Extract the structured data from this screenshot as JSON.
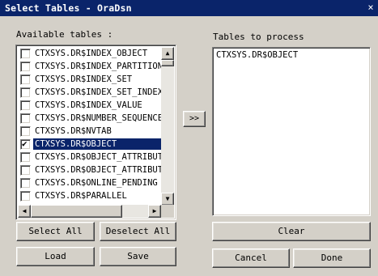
{
  "window": {
    "title": "Select Tables - OraDsn",
    "close_glyph": "×"
  },
  "available": {
    "label": "Available tables :",
    "items": [
      {
        "name": "CTXSYS.DR$INDEX_OBJECT",
        "checked": false,
        "selected": false
      },
      {
        "name": "CTXSYS.DR$INDEX_PARTITION",
        "checked": false,
        "selected": false
      },
      {
        "name": "CTXSYS.DR$INDEX_SET",
        "checked": false,
        "selected": false
      },
      {
        "name": "CTXSYS.DR$INDEX_SET_INDEX",
        "checked": false,
        "selected": false
      },
      {
        "name": "CTXSYS.DR$INDEX_VALUE",
        "checked": false,
        "selected": false
      },
      {
        "name": "CTXSYS.DR$NUMBER_SEQUENCE",
        "checked": false,
        "selected": false
      },
      {
        "name": "CTXSYS.DR$NVTAB",
        "checked": false,
        "selected": false
      },
      {
        "name": "CTXSYS.DR$OBJECT",
        "checked": true,
        "selected": true
      },
      {
        "name": "CTXSYS.DR$OBJECT_ATTRIBUTE",
        "checked": false,
        "selected": false
      },
      {
        "name": "CTXSYS.DR$OBJECT_ATTRIBUTE_",
        "checked": false,
        "selected": false
      },
      {
        "name": "CTXSYS.DR$ONLINE_PENDING",
        "checked": false,
        "selected": false
      },
      {
        "name": "CTXSYS.DR$PARALLEL",
        "checked": false,
        "selected": false
      }
    ],
    "check_glyph": "✔"
  },
  "scroll": {
    "up_glyph": "▲",
    "down_glyph": "▼",
    "left_glyph": "◀",
    "right_glyph": "▶"
  },
  "move_button_label": ">>",
  "process": {
    "label": "Tables to process",
    "items": [
      "CTXSYS.DR$OBJECT"
    ]
  },
  "buttons": {
    "select_all": "Select All",
    "deselect_all": "Deselect All",
    "load": "Load",
    "save": "Save",
    "clear": "Clear",
    "cancel": "Cancel",
    "done": "Done"
  },
  "colors": {
    "titlebar": "#0a246a",
    "face": "#d4d0c8",
    "selection": "#0a246a"
  }
}
